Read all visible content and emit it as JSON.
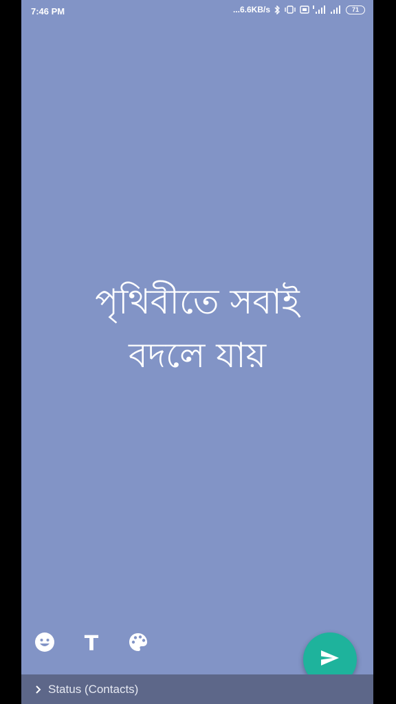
{
  "status_bar": {
    "time": "7:46 PM",
    "network_speed": "...6.6KB/s",
    "battery": "71",
    "icons": [
      "bluetooth-icon",
      "vibrate-icon",
      "volte-icon",
      "signal-4g-icon",
      "signal-icon"
    ]
  },
  "main": {
    "text_lines": [
      "পৃথিবীতে সবাই",
      "বদলে যায়"
    ],
    "background_color": "#8294c6"
  },
  "toolbar": {
    "emoji_icon": "emoji-icon",
    "text_tool_label": "T",
    "palette_icon": "palette-icon"
  },
  "send": {
    "icon": "send-icon",
    "color": "#1eb39c"
  },
  "bottom_bar": {
    "label": "Status (Contacts)",
    "icon": "chevron-right-icon"
  }
}
